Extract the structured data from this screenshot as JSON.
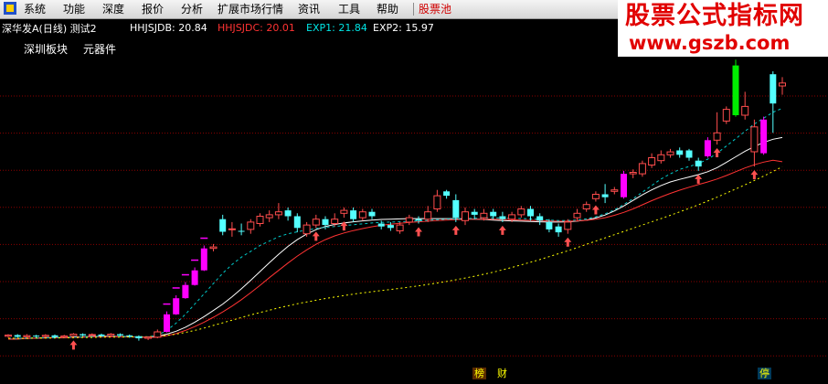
{
  "menu": {
    "items": [
      "系统",
      "功能",
      "深度",
      "报价",
      "分析",
      "扩展市场行情",
      "资讯",
      "工具",
      "帮助"
    ],
    "highlight": "股票池"
  },
  "watermark": {
    "title": "股票公式指标网",
    "url": "www.gszb.com"
  },
  "info": {
    "stock": "深华发A(日线) 测试2",
    "hhjsjdb": "HHJSJDB: 20.84",
    "hhjsjdc": "HHJSJDC: 20.01",
    "exp1": "EXP1: 21.84",
    "exp2": "EXP2: 15.97"
  },
  "tags": {
    "board": "深圳板块",
    "industry": "元器件"
  },
  "markers": {
    "bang": "榜",
    "cai": "财",
    "ting": "停"
  },
  "colors": {
    "up": "#ff4d4d",
    "down": "#54ffff",
    "magenta": "#ff00ff",
    "green": "#00ee00",
    "hhjsjdb": "#ffffff",
    "hhjsjdc": "#ff3333",
    "exp1": "#00c8c8",
    "exp2": "#ffff00",
    "gridline": "#8b0000",
    "info_stock": "#ffffff",
    "info_b": "#ffffff",
    "info_c": "#ff3333",
    "info_e1": "#00e5e5",
    "info_e2": "#ffffff"
  },
  "chart_data": {
    "type": "candlestick",
    "price_range": [
      13.2,
      23.6
    ],
    "candles": [
      {
        "o": 14.05,
        "c": 14.09,
        "h": 14.12,
        "l": 14.0,
        "k": "up"
      },
      {
        "o": 14.09,
        "c": 14.03,
        "h": 14.12,
        "l": 14.0,
        "k": "down"
      },
      {
        "o": 14.03,
        "c": 14.07,
        "h": 14.12,
        "l": 13.99,
        "k": "up"
      },
      {
        "o": 14.07,
        "c": 14.04,
        "h": 14.1,
        "l": 14.0,
        "k": "down"
      },
      {
        "o": 14.04,
        "c": 14.08,
        "h": 14.12,
        "l": 14.0,
        "k": "up"
      },
      {
        "o": 14.08,
        "c": 14.02,
        "h": 14.11,
        "l": 13.98,
        "k": "down"
      },
      {
        "o": 14.02,
        "c": 14.06,
        "h": 14.1,
        "l": 13.98,
        "k": "up"
      },
      {
        "o": 14.06,
        "c": 14.12,
        "h": 14.16,
        "l": 14.03,
        "k": "up"
      },
      {
        "o": 14.12,
        "c": 14.08,
        "h": 14.15,
        "l": 14.05,
        "k": "down"
      },
      {
        "o": 14.08,
        "c": 14.11,
        "h": 14.15,
        "l": 14.05,
        "k": "up"
      },
      {
        "o": 14.11,
        "c": 14.07,
        "h": 14.14,
        "l": 14.04,
        "k": "down"
      },
      {
        "o": 14.07,
        "c": 14.12,
        "h": 14.16,
        "l": 14.04,
        "k": "up"
      },
      {
        "o": 14.12,
        "c": 14.08,
        "h": 14.15,
        "l": 14.05,
        "k": "down"
      },
      {
        "o": 14.08,
        "c": 14.05,
        "h": 14.11,
        "l": 14.0,
        "k": "down"
      },
      {
        "o": 14.05,
        "c": 13.98,
        "h": 14.08,
        "l": 13.9,
        "k": "down"
      },
      {
        "o": 13.98,
        "c": 14.02,
        "h": 14.05,
        "l": 13.92,
        "k": "up"
      },
      {
        "o": 14.02,
        "c": 14.2,
        "h": 14.28,
        "l": 13.98,
        "k": "up"
      },
      {
        "o": 14.2,
        "c": 14.8,
        "h": 14.9,
        "l": 14.18,
        "k": "magenta"
      },
      {
        "o": 14.8,
        "c": 15.35,
        "h": 15.45,
        "l": 14.78,
        "k": "magenta"
      },
      {
        "o": 15.35,
        "c": 15.8,
        "h": 15.9,
        "l": 15.33,
        "k": "magenta"
      },
      {
        "o": 15.8,
        "c": 16.3,
        "h": 16.4,
        "l": 15.78,
        "k": "magenta"
      },
      {
        "o": 16.3,
        "c": 17.05,
        "h": 17.15,
        "l": 16.28,
        "k": "magenta"
      },
      {
        "o": 17.05,
        "c": 17.1,
        "h": 17.2,
        "l": 16.95,
        "k": "up"
      },
      {
        "o": 18.05,
        "c": 17.62,
        "h": 18.2,
        "l": 17.5,
        "k": "down"
      },
      {
        "o": 17.72,
        "c": 17.72,
        "h": 17.95,
        "l": 17.45,
        "k": "up"
      },
      {
        "o": 17.65,
        "c": 17.62,
        "h": 17.9,
        "l": 17.5,
        "k": "down"
      },
      {
        "o": 17.7,
        "c": 17.95,
        "h": 18.05,
        "l": 17.55,
        "k": "up"
      },
      {
        "o": 17.9,
        "c": 18.15,
        "h": 18.25,
        "l": 17.8,
        "k": "up"
      },
      {
        "o": 18.1,
        "c": 18.2,
        "h": 18.35,
        "l": 17.95,
        "k": "up"
      },
      {
        "o": 18.2,
        "c": 18.3,
        "h": 18.6,
        "l": 18.05,
        "k": "up"
      },
      {
        "o": 18.35,
        "c": 18.15,
        "h": 18.45,
        "l": 18.0,
        "k": "down"
      },
      {
        "o": 18.15,
        "c": 17.75,
        "h": 18.25,
        "l": 17.6,
        "k": "down"
      },
      {
        "o": 17.55,
        "c": 17.85,
        "h": 17.95,
        "l": 17.45,
        "k": "up"
      },
      {
        "o": 17.85,
        "c": 18.05,
        "h": 18.2,
        "l": 17.75,
        "k": "up"
      },
      {
        "o": 18.05,
        "c": 17.85,
        "h": 18.15,
        "l": 17.7,
        "k": "down"
      },
      {
        "o": 17.9,
        "c": 18.05,
        "h": 18.25,
        "l": 17.8,
        "k": "up"
      },
      {
        "o": 18.25,
        "c": 18.35,
        "h": 18.45,
        "l": 18.1,
        "k": "up"
      },
      {
        "o": 18.35,
        "c": 18.05,
        "h": 18.45,
        "l": 17.95,
        "k": "down"
      },
      {
        "o": 18.1,
        "c": 18.3,
        "h": 18.4,
        "l": 18.0,
        "k": "up"
      },
      {
        "o": 18.3,
        "c": 18.15,
        "h": 18.4,
        "l": 18.05,
        "k": "down"
      },
      {
        "o": 17.9,
        "c": 17.8,
        "h": 18.0,
        "l": 17.7,
        "k": "down"
      },
      {
        "o": 17.85,
        "c": 17.75,
        "h": 17.95,
        "l": 17.65,
        "k": "down"
      },
      {
        "o": 17.65,
        "c": 17.85,
        "h": 17.95,
        "l": 17.55,
        "k": "up"
      },
      {
        "o": 17.95,
        "c": 18.1,
        "h": 18.2,
        "l": 17.85,
        "k": "up"
      },
      {
        "o": 18.05,
        "c": 18.0,
        "h": 18.15,
        "l": 17.9,
        "k": "down"
      },
      {
        "o": 18.05,
        "c": 18.3,
        "h": 18.5,
        "l": 17.95,
        "k": "up"
      },
      {
        "o": 18.4,
        "c": 18.85,
        "h": 19.05,
        "l": 18.3,
        "k": "up"
      },
      {
        "o": 19.0,
        "c": 18.85,
        "h": 19.05,
        "l": 18.75,
        "k": "down"
      },
      {
        "o": 18.7,
        "c": 18.1,
        "h": 18.9,
        "l": 17.95,
        "k": "down"
      },
      {
        "o": 18.0,
        "c": 18.3,
        "h": 18.45,
        "l": 17.85,
        "k": "up"
      },
      {
        "o": 18.3,
        "c": 18.2,
        "h": 18.4,
        "l": 18.05,
        "k": "down"
      },
      {
        "o": 18.1,
        "c": 18.25,
        "h": 18.4,
        "l": 18.0,
        "k": "up"
      },
      {
        "o": 18.3,
        "c": 18.15,
        "h": 18.4,
        "l": 18.05,
        "k": "down"
      },
      {
        "o": 18.15,
        "c": 18.05,
        "h": 18.3,
        "l": 17.95,
        "k": "down"
      },
      {
        "o": 18.05,
        "c": 18.2,
        "h": 18.3,
        "l": 17.95,
        "k": "up"
      },
      {
        "o": 18.2,
        "c": 18.4,
        "h": 18.5,
        "l": 18.1,
        "k": "up"
      },
      {
        "o": 18.4,
        "c": 18.15,
        "h": 18.5,
        "l": 18.0,
        "k": "down"
      },
      {
        "o": 18.15,
        "c": 18.0,
        "h": 18.25,
        "l": 17.85,
        "k": "down"
      },
      {
        "o": 17.95,
        "c": 17.7,
        "h": 18.05,
        "l": 17.6,
        "k": "down"
      },
      {
        "o": 17.8,
        "c": 17.6,
        "h": 17.9,
        "l": 17.45,
        "k": "down"
      },
      {
        "o": 17.7,
        "c": 17.95,
        "h": 18.05,
        "l": 17.55,
        "k": "up"
      },
      {
        "o": 18.1,
        "c": 18.25,
        "h": 18.4,
        "l": 18.0,
        "k": "up"
      },
      {
        "o": 18.4,
        "c": 18.55,
        "h": 18.65,
        "l": 18.3,
        "k": "up"
      },
      {
        "o": 18.75,
        "c": 18.9,
        "h": 19.0,
        "l": 18.65,
        "k": "up"
      },
      {
        "o": 18.9,
        "c": 18.8,
        "h": 19.25,
        "l": 18.6,
        "k": "down"
      },
      {
        "o": 19.0,
        "c": 19.05,
        "h": 19.15,
        "l": 18.9,
        "k": "up"
      },
      {
        "o": 18.8,
        "c": 19.6,
        "h": 19.7,
        "l": 18.75,
        "k": "magenta"
      },
      {
        "o": 19.6,
        "c": 19.65,
        "h": 19.75,
        "l": 19.45,
        "k": "up"
      },
      {
        "o": 19.6,
        "c": 19.95,
        "h": 20.05,
        "l": 19.5,
        "k": "up"
      },
      {
        "o": 19.9,
        "c": 20.15,
        "h": 20.3,
        "l": 19.8,
        "k": "up"
      },
      {
        "o": 20.05,
        "c": 20.25,
        "h": 20.4,
        "l": 19.95,
        "k": "up"
      },
      {
        "o": 20.25,
        "c": 20.35,
        "h": 20.45,
        "l": 20.15,
        "k": "up"
      },
      {
        "o": 20.4,
        "c": 20.25,
        "h": 20.5,
        "l": 20.15,
        "k": "down"
      },
      {
        "o": 20.4,
        "c": 20.15,
        "h": 20.45,
        "l": 20.05,
        "k": "down"
      },
      {
        "o": 20.05,
        "c": 19.85,
        "h": 20.15,
        "l": 19.7,
        "k": "down"
      },
      {
        "o": 20.2,
        "c": 20.75,
        "h": 20.85,
        "l": 20.15,
        "k": "magenta"
      },
      {
        "o": 20.75,
        "c": 21.0,
        "h": 21.7,
        "l": 20.6,
        "k": "up"
      },
      {
        "o": 21.4,
        "c": 21.8,
        "h": 21.9,
        "l": 21.3,
        "k": "up"
      },
      {
        "o": 21.6,
        "c": 23.3,
        "h": 23.5,
        "l": 21.55,
        "k": "green"
      },
      {
        "o": 21.6,
        "c": 21.9,
        "h": 22.4,
        "l": 21.45,
        "k": "up"
      },
      {
        "o": 21.2,
        "c": 20.35,
        "h": 21.45,
        "l": 19.85,
        "k": "up"
      },
      {
        "o": 20.3,
        "c": 21.45,
        "h": 21.55,
        "l": 20.25,
        "k": "magenta"
      },
      {
        "o": 22.0,
        "c": 23.0,
        "h": 23.1,
        "l": 21.0,
        "k": "down"
      },
      {
        "o": 22.7,
        "c": 22.6,
        "h": 22.9,
        "l": 22.3,
        "k": "up"
      }
    ],
    "series": [
      {
        "name": "HHJSJDB",
        "values": [
          13.95,
          13.96,
          13.97,
          13.99,
          14.0,
          14.0,
          14.0,
          14.02,
          14.03,
          14.04,
          14.05,
          14.05,
          14.04,
          14.03,
          14.02,
          14.02,
          14.05,
          14.12,
          14.22,
          14.36,
          14.53,
          14.72,
          14.93,
          15.15,
          15.4,
          15.67,
          15.96,
          16.26,
          16.56,
          16.85,
          17.12,
          17.35,
          17.54,
          17.69,
          17.8,
          17.87,
          17.92,
          17.96,
          17.99,
          18.02,
          18.04,
          18.05,
          18.06,
          18.07,
          18.07,
          18.07,
          18.07,
          18.07,
          18.07,
          18.06,
          18.05,
          18.04,
          18.02,
          18.0,
          17.99,
          17.98,
          17.97,
          17.96,
          17.95,
          17.95,
          17.96,
          17.98,
          18.02,
          18.09,
          18.19,
          18.33,
          18.5,
          18.69,
          18.88,
          19.05,
          19.2,
          19.32,
          19.41,
          19.49,
          19.57,
          19.67,
          19.81,
          19.99,
          20.18,
          20.37,
          20.53,
          20.67,
          20.78,
          20.84
        ]
      },
      {
        "name": "HHJSJDC",
        "values": [
          13.95,
          13.96,
          13.97,
          13.98,
          13.99,
          14.0,
          14.0,
          14.01,
          14.02,
          14.03,
          14.03,
          14.04,
          14.03,
          14.03,
          14.02,
          14.01,
          14.02,
          14.07,
          14.14,
          14.25,
          14.38,
          14.53,
          14.7,
          14.88,
          15.08,
          15.3,
          15.54,
          15.79,
          16.05,
          16.3,
          16.55,
          16.79,
          17.0,
          17.19,
          17.35,
          17.48,
          17.58,
          17.66,
          17.73,
          17.79,
          17.84,
          17.88,
          17.91,
          17.94,
          17.96,
          17.98,
          18.0,
          18.02,
          18.03,
          18.04,
          18.05,
          18.05,
          18.05,
          18.04,
          18.03,
          18.02,
          18.01,
          18.0,
          17.99,
          17.98,
          17.98,
          17.99,
          18.01,
          18.05,
          18.1,
          18.18,
          18.28,
          18.4,
          18.54,
          18.68,
          18.81,
          18.93,
          19.04,
          19.14,
          19.23,
          19.32,
          19.42,
          19.54,
          19.67,
          19.8,
          19.91,
          20.0,
          20.06,
          20.01
        ]
      },
      {
        "name": "EXP1",
        "values": [
          13.98,
          13.98,
          13.99,
          13.99,
          14.0,
          14.0,
          14.01,
          14.02,
          14.03,
          14.04,
          14.05,
          14.06,
          14.05,
          14.04,
          14.03,
          14.03,
          14.08,
          14.25,
          14.5,
          14.8,
          15.15,
          15.5,
          15.85,
          16.2,
          16.5,
          16.75,
          16.95,
          17.15,
          17.3,
          17.45,
          17.55,
          17.62,
          17.68,
          17.73,
          17.77,
          17.8,
          17.83,
          17.86,
          17.89,
          17.92,
          17.94,
          17.95,
          17.96,
          17.98,
          17.99,
          18.01,
          18.03,
          18.05,
          18.06,
          18.07,
          18.08,
          18.09,
          18.09,
          18.09,
          18.08,
          18.07,
          18.06,
          18.04,
          18.02,
          18.0,
          18.0,
          18.02,
          18.06,
          18.13,
          18.23,
          18.37,
          18.55,
          18.75,
          18.97,
          19.2,
          19.42,
          19.6,
          19.75,
          19.85,
          19.95,
          20.1,
          20.3,
          20.55,
          20.8,
          21.05,
          21.3,
          21.5,
          21.7,
          21.84
        ]
      },
      {
        "name": "EXP2",
        "values": [
          13.98,
          13.98,
          13.98,
          13.99,
          13.99,
          13.99,
          14.0,
          14.0,
          14.01,
          14.01,
          14.02,
          14.02,
          14.02,
          14.03,
          14.03,
          14.03,
          14.05,
          14.08,
          14.12,
          14.18,
          14.25,
          14.33,
          14.42,
          14.51,
          14.6,
          14.69,
          14.78,
          14.86,
          14.94,
          15.02,
          15.09,
          15.16,
          15.22,
          15.28,
          15.34,
          15.39,
          15.44,
          15.49,
          15.53,
          15.57,
          15.61,
          15.65,
          15.69,
          15.73,
          15.77,
          15.82,
          15.87,
          15.92,
          15.98,
          16.04,
          16.1,
          16.17,
          16.24,
          16.32,
          16.4,
          16.49,
          16.58,
          16.67,
          16.77,
          16.87,
          16.97,
          17.08,
          17.19,
          17.3,
          17.41,
          17.52,
          17.63,
          17.74,
          17.85,
          17.96,
          18.07,
          18.18,
          18.3,
          18.42,
          18.54,
          18.67,
          18.8,
          18.94,
          19.08,
          19.22,
          19.37,
          19.52,
          19.68,
          19.84
        ]
      }
    ],
    "up_arrows": [
      7,
      33,
      36,
      44,
      48,
      53,
      60,
      63,
      74,
      76,
      80
    ],
    "sell_markers": [
      17,
      18,
      19,
      20,
      21
    ],
    "top_markers": [
      24,
      28,
      30,
      34,
      36,
      46,
      48,
      50,
      52,
      66,
      78
    ]
  }
}
